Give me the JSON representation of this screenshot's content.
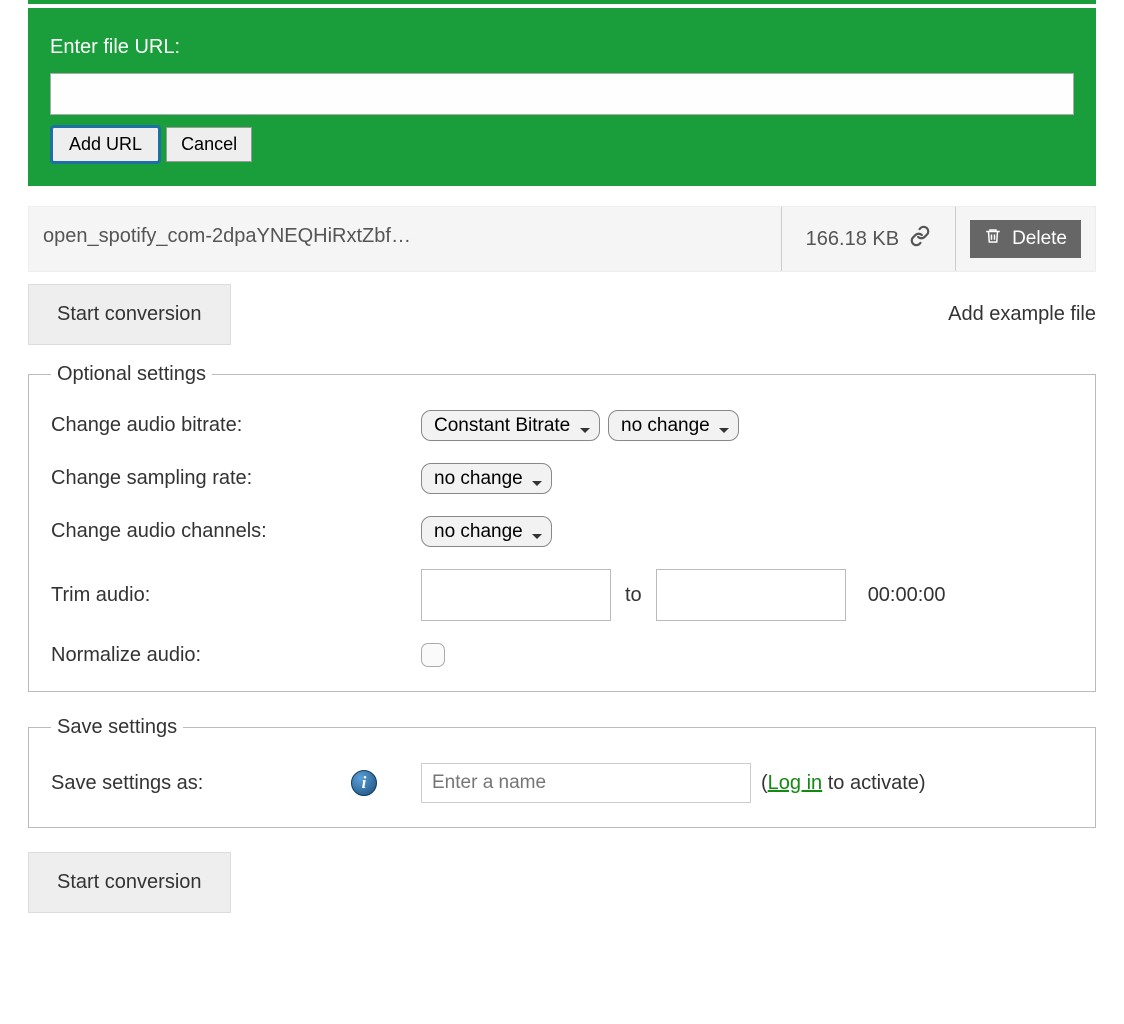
{
  "url_panel": {
    "label": "Enter file URL:",
    "add_url_label": "Add URL",
    "cancel_label": "Cancel"
  },
  "file": {
    "name": "open_spotify_com-2dpaYNEQHiRxtZbf…",
    "size": "166.18 KB",
    "delete_label": "Delete"
  },
  "actions": {
    "start_conversion_label": "Start conversion",
    "add_example_label": "Add example file"
  },
  "optional": {
    "legend": "Optional settings",
    "bitrate": {
      "label": "Change audio bitrate:",
      "mode": "Constant Bitrate",
      "value": "no change"
    },
    "sampling": {
      "label": "Change sampling rate:",
      "value": "no change"
    },
    "channels": {
      "label": "Change audio channels:",
      "value": "no change"
    },
    "trim": {
      "label": "Trim audio:",
      "separator": "to",
      "duration": "00:00:00"
    },
    "normalize": {
      "label": "Normalize audio:"
    }
  },
  "save": {
    "legend": "Save settings",
    "label": "Save settings as:",
    "placeholder": "Enter a name",
    "note_prefix": "(",
    "login_text": "Log in",
    "note_suffix": " to activate)"
  }
}
